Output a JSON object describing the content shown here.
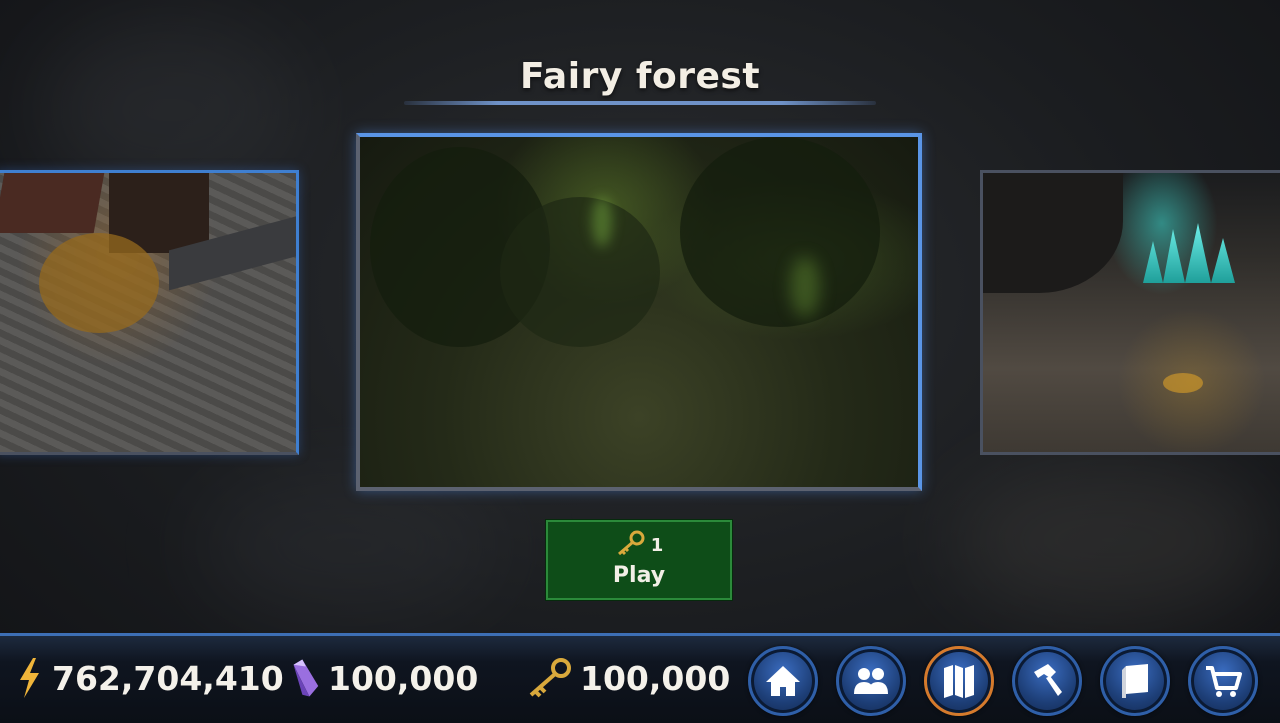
{
  "stage": {
    "title": "Fairy forest",
    "cards": [
      {
        "name": "village",
        "position": "left"
      },
      {
        "name": "fairy-forest",
        "position": "center",
        "selected": true
      },
      {
        "name": "crystal-cave",
        "position": "right"
      }
    ]
  },
  "play_button": {
    "cost_icon": "key-icon",
    "cost": "1",
    "label": "Play"
  },
  "resources": {
    "energy": {
      "icon": "lightning-icon",
      "value": "762,704,410"
    },
    "crystals": {
      "icon": "crystal-icon",
      "value": "100,000"
    },
    "keys": {
      "icon": "key-icon",
      "value": "100,000"
    }
  },
  "nav": [
    {
      "icon": "home-icon"
    },
    {
      "icon": "party-icon"
    },
    {
      "icon": "map-icon",
      "active": true
    },
    {
      "icon": "hammer-icon"
    },
    {
      "icon": "book-icon"
    },
    {
      "icon": "cart-icon"
    }
  ],
  "colors": {
    "accent_blue": "#3d6fb5",
    "play_green": "#0e4d18",
    "active_nav": "#d57a2c",
    "gold": "#d9a93c"
  }
}
